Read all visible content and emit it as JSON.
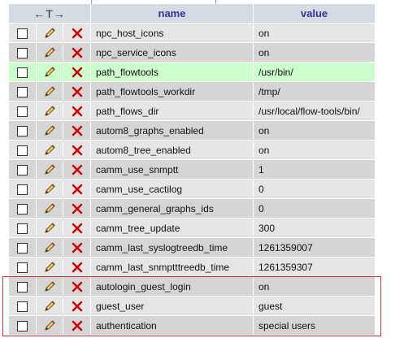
{
  "header": {
    "nav_arrows": "←T→",
    "name_label": "name",
    "value_label": "value"
  },
  "rows": [
    {
      "name": "npc_host_icons",
      "value": "on",
      "highlight": false
    },
    {
      "name": "npc_service_icons",
      "value": "on",
      "highlight": false
    },
    {
      "name": "path_flowtools",
      "value": "/usr/bin/",
      "highlight": true
    },
    {
      "name": "path_flowtools_workdir",
      "value": "/tmp/",
      "highlight": false
    },
    {
      "name": "path_flows_dir",
      "value": "/usr/local/flow-tools/bin/",
      "highlight": false
    },
    {
      "name": "autom8_graphs_enabled",
      "value": "on",
      "highlight": false
    },
    {
      "name": "autom8_tree_enabled",
      "value": "on",
      "highlight": false
    },
    {
      "name": "camm_use_snmptt",
      "value": "1",
      "highlight": false
    },
    {
      "name": "camm_use_cactilog",
      "value": "0",
      "highlight": false
    },
    {
      "name": "camm_general_graphs_ids",
      "value": "0",
      "highlight": false
    },
    {
      "name": "camm_tree_update",
      "value": "300",
      "highlight": false
    },
    {
      "name": "camm_last_syslogtreedb_time",
      "value": "1261359007",
      "highlight": false
    },
    {
      "name": "camm_last_snmptttreedb_time",
      "value": "1261359307",
      "highlight": false
    },
    {
      "name": "autologin_guest_login",
      "value": "on",
      "highlight": false
    },
    {
      "name": "guest_user",
      "value": "guest",
      "highlight": false
    },
    {
      "name": "authentication",
      "value": "special users",
      "highlight": false
    }
  ],
  "icons": {
    "edit": "pencil-icon",
    "delete": "delete-x-icon"
  },
  "colors": {
    "header_bg": "#d3dce3",
    "header_text": "#333399",
    "row_light": "#e5e5e5",
    "row_dark": "#d5d5d5",
    "row_highlight": "#ccffcc",
    "annotation_box": "#cc3333",
    "delete_icon": "#cc0000"
  }
}
